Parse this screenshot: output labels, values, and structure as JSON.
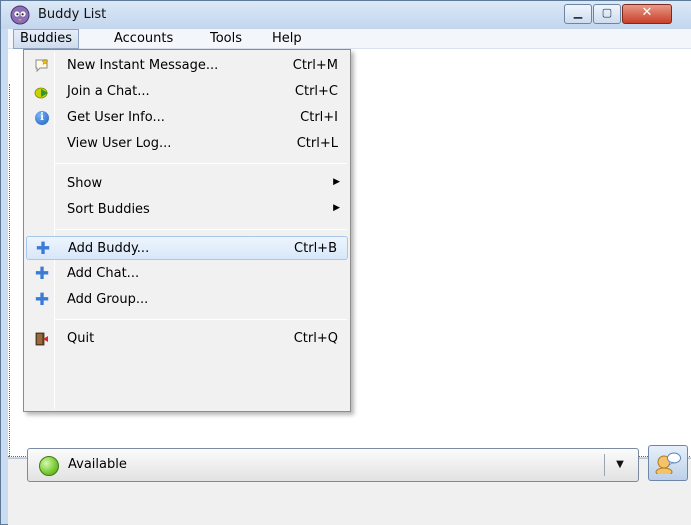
{
  "window": {
    "title": "Buddy List",
    "icons": {
      "app": "pidgin-icon",
      "minimize": "minimize-icon",
      "maximize": "maximize-icon",
      "close": "close-icon"
    }
  },
  "menubar": {
    "items": [
      {
        "label": "Buddies",
        "open": true
      },
      {
        "label": "Accounts"
      },
      {
        "label": "Tools"
      },
      {
        "label": "Help"
      }
    ]
  },
  "buddies_menu": {
    "items": [
      {
        "label": "New Instant Message...",
        "shortcut": "Ctrl+M",
        "icon": "new-message-icon"
      },
      {
        "label": "Join a Chat...",
        "shortcut": "Ctrl+C",
        "icon": "join-chat-icon"
      },
      {
        "label": "Get User Info...",
        "shortcut": "Ctrl+I",
        "icon": "info-icon"
      },
      {
        "label": "View User Log...",
        "shortcut": "Ctrl+L"
      },
      {
        "label": "Show",
        "submenu": true
      },
      {
        "label": "Sort Buddies",
        "submenu": true
      },
      {
        "label": "Add Buddy...",
        "shortcut": "Ctrl+B",
        "icon": "add-icon",
        "highlighted": true
      },
      {
        "label": "Add Chat...",
        "icon": "add-icon"
      },
      {
        "label": "Add Group...",
        "icon": "add-icon"
      },
      {
        "label": "Quit",
        "shortcut": "Ctrl+Q",
        "icon": "quit-icon"
      }
    ]
  },
  "status": {
    "label": "Available",
    "color": "#7ccc37",
    "icon": "available-status-icon"
  },
  "colors": {
    "frame": "#c9dcf1",
    "menu_highlight": "#d7e7f9",
    "add_icon": "#3b7bd6"
  }
}
